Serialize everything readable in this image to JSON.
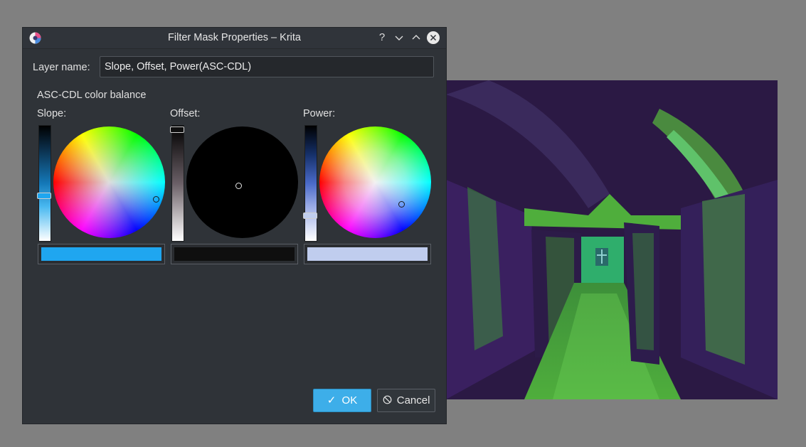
{
  "window": {
    "title": "Filter Mask Properties – Krita",
    "help_glyph": "?",
    "minimize_glyph": "⌄",
    "maximize_glyph": "⌃"
  },
  "form": {
    "layer_name_label": "Layer name:",
    "layer_name_value": "Slope, Offset, Power(ASC-CDL)"
  },
  "filter": {
    "section_label": "ASC-CDL  color balance",
    "slope": {
      "label": "Slope:",
      "color": "#1fa6f0",
      "level": 0.62
    },
    "offset": {
      "label": "Offset:",
      "color": "#0f0f0f",
      "level": 0.0
    },
    "power": {
      "label": "Power:",
      "color": "#c0cdee",
      "level": 0.23
    }
  },
  "buttons": {
    "ok_check": "✓",
    "ok": "OK",
    "cancel_icon": "⃠",
    "cancel": "Cancel"
  },
  "colors": {
    "accent": "#3daee9",
    "dialog_bg": "#2f3338",
    "desktop_bg": "#808080"
  }
}
